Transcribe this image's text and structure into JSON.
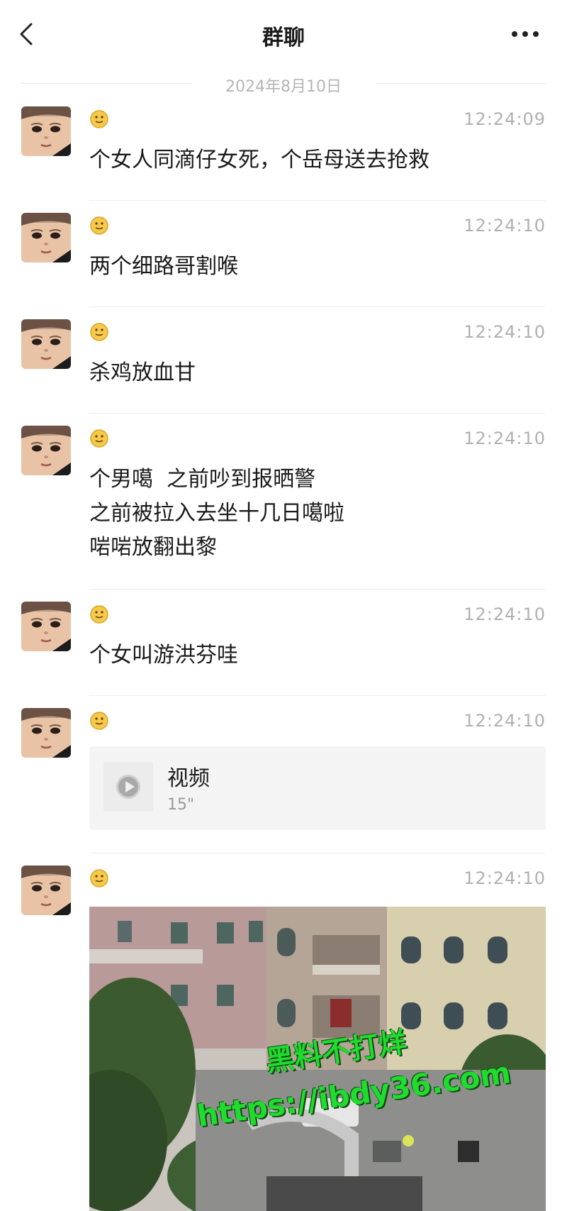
{
  "header": {
    "title": "群聊"
  },
  "date_divider": "2024年8月10日",
  "icons": {
    "back": "chevron-left-icon",
    "more": "more-dots-icon",
    "nickname_emoji": "smiley-face-icon",
    "play": "play-icon"
  },
  "messages": [
    {
      "time": "12:24:09",
      "text": "个女人同滴仔女死，个岳母送去抢救"
    },
    {
      "time": "12:24:10",
      "text": "两个细路哥割喉"
    },
    {
      "time": "12:24:10",
      "text": "杀鸡放血甘"
    },
    {
      "time": "12:24:10",
      "lines": [
        "个男噶  之前吵到报晒警",
        "之前被拉入去坐十几日噶啦",
        "啱啱放翻出黎"
      ]
    },
    {
      "time": "12:24:10",
      "text": "个女叫游洪芬哇"
    },
    {
      "time": "12:24:10",
      "video": {
        "title": "视频",
        "duration": "15\""
      }
    },
    {
      "time": "12:24:10",
      "image": "street-photo"
    }
  ],
  "watermark": {
    "line1": "黑料不打烊",
    "line2": "https://ibdy36.com"
  },
  "colors": {
    "watermark": "#1fdc2f",
    "time": "#b0b0b0",
    "divider": "#e6e6e6"
  }
}
